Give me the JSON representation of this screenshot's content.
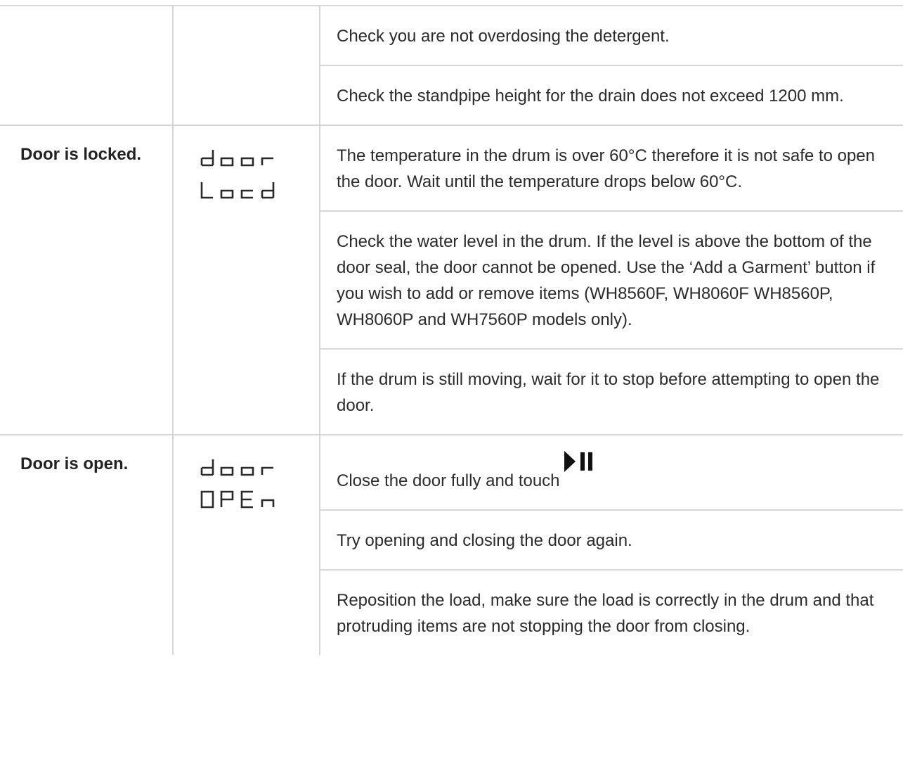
{
  "rows": [
    {
      "condition": "",
      "display": null,
      "solutions": [
        "Check you are not overdosing the detergent.",
        "Check the standpipe height for the drain does not exceed 1200 mm."
      ]
    },
    {
      "condition": "Door is locked.",
      "display": [
        "door",
        "Locd"
      ],
      "solutions": [
        "The temperature in the drum is over 60°C therefore it is not safe to open the door. Wait until the temperature drops below 60°C.",
        "Check the water level in the drum. If the level is above the bottom of the door seal, the door cannot be opened. Use the ‘Add a Garment’ button if you wish to add or remove items (WH8560F, WH8060F WH8560P, WH8060P and WH7560P models only).",
        "If the drum is still moving, wait for it to stop before attempting to open the door."
      ]
    },
    {
      "condition": "Door is open.",
      "display": [
        "door",
        "OPEn"
      ],
      "solutions": [
        "Close the door fully and touch",
        "Try opening and closing the door again.",
        "Reposition the load, make sure the load is correctly in the drum and that protruding items are not stopping the door from closing."
      ],
      "solution_icon": "play-pause-icon"
    }
  ]
}
